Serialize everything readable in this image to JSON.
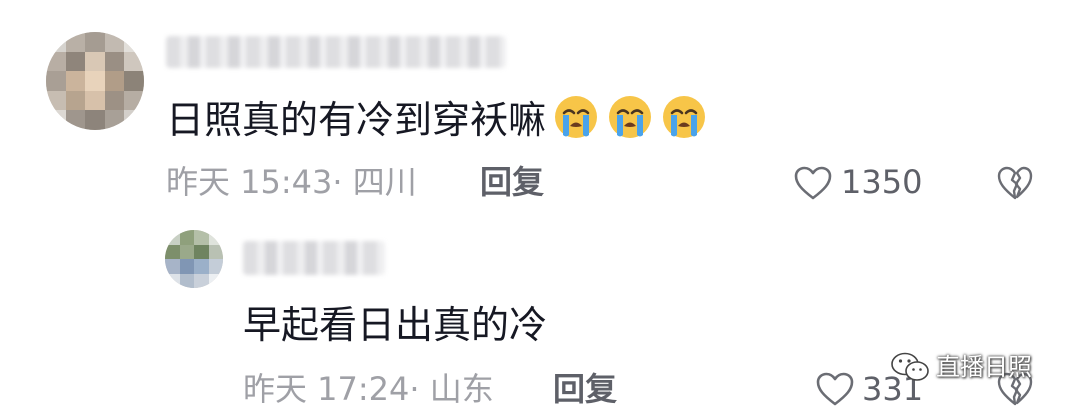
{
  "comments": [
    {
      "text": "日照真的有冷到穿袄嘛",
      "emojis": [
        "loudly-crying-face",
        "loudly-crying-face",
        "loudly-crying-face"
      ],
      "meta": "昨天 15:43· 四川",
      "reply_label": "回复",
      "like_count": "1350"
    },
    {
      "text": "早起看日出真的冷",
      "meta": "昨天 17:24· 山东",
      "reply_label": "回复",
      "like_count": "331"
    }
  ],
  "watermark": {
    "text": "直播日照",
    "icon": "wechat-official-account-icon"
  },
  "colors": {
    "text": "#161823",
    "meta": "#9fa0a6",
    "action": "#5e6068",
    "emoji_face": "#f7c548",
    "emoji_tears": "#4aa3ea"
  }
}
